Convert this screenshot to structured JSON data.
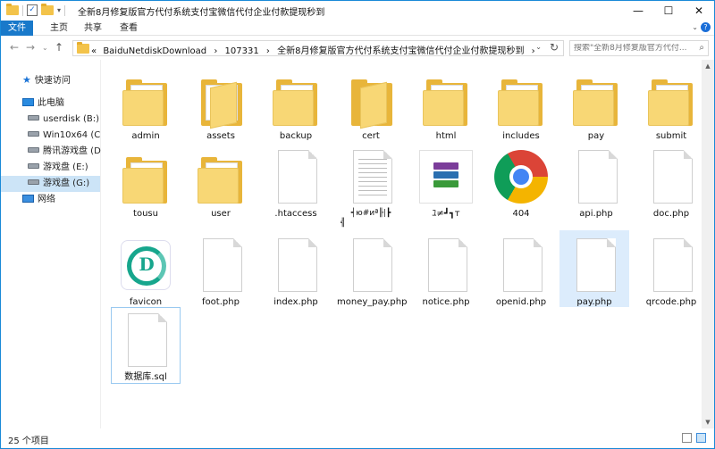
{
  "window": {
    "title": "全新8月修复版官方代付系统支付宝微信代付企业付款提现秒到",
    "minimize": "—",
    "maximize": "☐",
    "close": "✕"
  },
  "ribbon": {
    "tabs": [
      "文件",
      "主页",
      "共享",
      "查看"
    ],
    "help": "?"
  },
  "address": {
    "prefix": "«",
    "path": [
      "BaiduNetdiskDownload",
      "107331",
      "全新8月修复版官方代付系统支付宝微信代付企业付款提现秒到"
    ],
    "separator": "›"
  },
  "search": {
    "placeholder": "搜索\"全新8月修复版官方代付..."
  },
  "sidebar": {
    "items": [
      {
        "label": "快速访问",
        "icon": "star-icon"
      },
      {
        "label": "此电脑",
        "icon": "computer-icon"
      },
      {
        "label": "userdisk (B:)",
        "icon": "drive-icon"
      },
      {
        "label": "Win10x64 (C:)",
        "icon": "drive-icon"
      },
      {
        "label": "腾讯游戏盘 (D:)",
        "icon": "drive-icon"
      },
      {
        "label": "游戏盘 (E:)",
        "icon": "drive-icon"
      },
      {
        "label": "游戏盘 (G:)",
        "icon": "drive-icon"
      },
      {
        "label": "网络",
        "icon": "network-icon"
      }
    ]
  },
  "files": [
    {
      "name": "admin",
      "type": "folder"
    },
    {
      "name": "assets",
      "type": "folder-open"
    },
    {
      "name": "backup",
      "type": "folder"
    },
    {
      "name": "cert",
      "type": "folder-open"
    },
    {
      "name": "html",
      "type": "folder"
    },
    {
      "name": "includes",
      "type": "folder"
    },
    {
      "name": "pay",
      "type": "folder"
    },
    {
      "name": "submit",
      "type": "folder"
    },
    {
      "name": "tousu",
      "type": "folder"
    },
    {
      "name": "user",
      "type": "folder"
    },
    {
      "name": ".htaccess",
      "type": "file"
    },
    {
      "name": "┥ю#иª╟|┣",
      "name2": "╣",
      "type": "text"
    },
    {
      "name": "ﾕ≠┛┓т",
      "type": "rar"
    },
    {
      "name": "404",
      "type": "chrome"
    },
    {
      "name": "api.php",
      "type": "file"
    },
    {
      "name": "doc.php",
      "type": "file"
    },
    {
      "name": "favicon",
      "type": "favicon"
    },
    {
      "name": "foot.php",
      "type": "file"
    },
    {
      "name": "index.php",
      "type": "file"
    },
    {
      "name": "money_pay.php",
      "type": "file"
    },
    {
      "name": "notice.php",
      "type": "file"
    },
    {
      "name": "openid.php",
      "type": "file"
    },
    {
      "name": "pay.php",
      "type": "file"
    },
    {
      "name": "qrcode.php",
      "type": "file"
    },
    {
      "name": "数据库.sql",
      "type": "file"
    }
  ],
  "status": {
    "count": "25 个项目"
  }
}
